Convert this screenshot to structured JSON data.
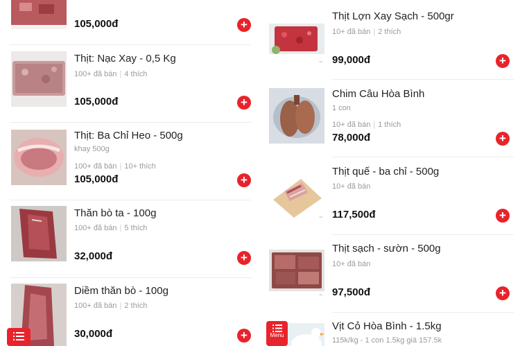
{
  "left_items": [
    {
      "name": "",
      "sub": "",
      "sold": "",
      "likes": "",
      "price": "105,000đ"
    },
    {
      "name": "Thịt: Nạc Xay - 0,5  Kg",
      "sub": "",
      "sold": "100+ đã bán",
      "likes": "4 thích",
      "price": "105,000đ"
    },
    {
      "name": "Thịt: Ba Chỉ Heo - 500g",
      "sub": "khay 500g",
      "sold": "100+ đã bán",
      "likes": "10+ thích",
      "price": "105,000đ"
    },
    {
      "name": "Thăn  bò ta - 100g",
      "sub": "",
      "sold": "100+ đã bán",
      "likes": "5 thích",
      "price": "32,000đ"
    },
    {
      "name": "Diềm thăn bò - 100g",
      "sub": "",
      "sold": "100+ đã bán",
      "likes": "2 thích",
      "price": "30,000đ"
    }
  ],
  "right_items": [
    {
      "name": "Thịt Lợn Xay Sạch - 500gr",
      "sub": "",
      "sold": "10+ đã bán",
      "likes": "2 thích",
      "price": "99,000đ"
    },
    {
      "name": "Chim Câu Hòa Bình",
      "sub": "1 con",
      "sold": "10+ đã bán",
      "likes": "1 thích",
      "price": "78,000đ"
    },
    {
      "name": "Thịt quế - ba chỉ - 500g",
      "sub": "",
      "sold": "10+ đã bán",
      "likes": "",
      "price": "117,500đ"
    },
    {
      "name": "Thịt sạch - sườn - 500g",
      "sub": "",
      "sold": "10+ đã bán",
      "likes": "",
      "price": "97,500đ"
    },
    {
      "name": "Vịt Cỏ Hòa Bình - 1.5kg",
      "sub": "115k/kg - 1 con 1.5kg giá 157.5k",
      "sold": "",
      "likes": "",
      "price": ""
    }
  ],
  "add_symbol": "+",
  "menu": {
    "label": "Menu"
  },
  "icons": {
    "add": "plus-circle-icon",
    "menu": "menu-list-icon"
  },
  "colors": {
    "accent": "#e8232b",
    "muted": "#9a9a9a"
  }
}
